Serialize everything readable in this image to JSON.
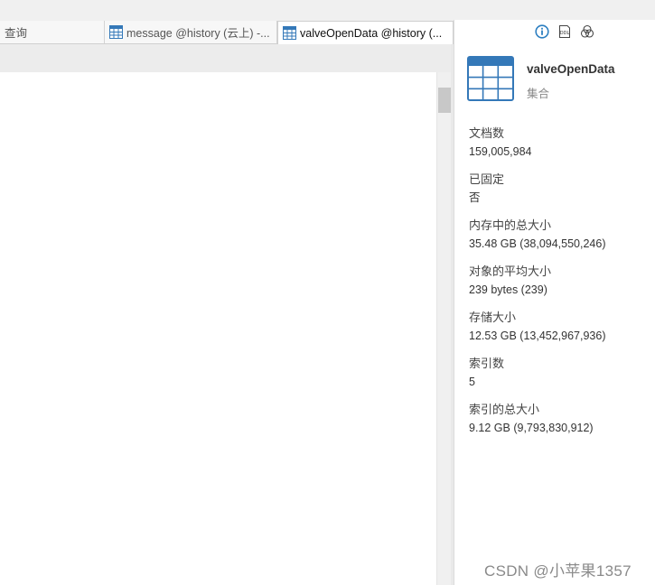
{
  "tabs": [
    {
      "label": "查询",
      "icon": "none"
    },
    {
      "label": "message @history (云上) -...",
      "icon": "table-icon"
    },
    {
      "label": "valveOpenData @history (...",
      "icon": "table-icon",
      "active": true
    }
  ],
  "toolbar_icons": [
    "info-icon",
    "ddl-icon",
    "filter-circles-icon"
  ],
  "ddl_icon_text": "DDL",
  "collection": {
    "name": "valveOpenData",
    "type": "集合"
  },
  "properties": [
    {
      "label": "文档数",
      "value": "159,005,984"
    },
    {
      "label": "已固定",
      "value": "否"
    },
    {
      "label": "内存中的总大小",
      "value": "35.48 GB (38,094,550,246)"
    },
    {
      "label": "对象的平均大小",
      "value": "239 bytes (239)"
    },
    {
      "label": "存储大小",
      "value": "12.53 GB (13,452,967,936)"
    },
    {
      "label": "索引数",
      "value": "5"
    },
    {
      "label": "索引的总大小",
      "value": "9.12 GB (9,793,830,912)"
    }
  ],
  "watermark": "CSDN @小苹果1357",
  "colors": {
    "accent": "#2d7fc1",
    "table_icon": "#3478b8"
  }
}
